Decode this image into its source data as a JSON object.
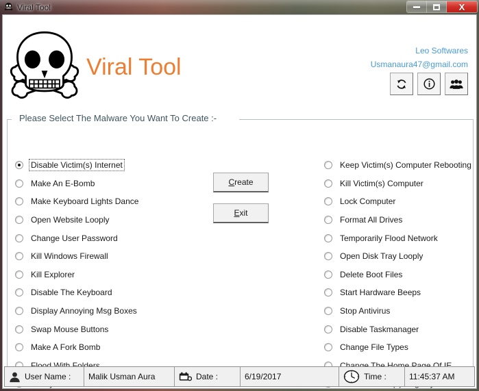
{
  "window": {
    "title": "Viral Tool",
    "icon": "skull-icon",
    "controls": {
      "minimize": "minimize-button",
      "maximize": "maximize-button",
      "close": "X"
    }
  },
  "header": {
    "logo_icon": "skull-and-crossbones-icon",
    "app_title": "Viral Tool",
    "app_title_color": "#ED7D31",
    "company": "Leo Softwares",
    "email": "Usmanaura47@gmail.com",
    "link_color": "#4a9ad6",
    "buttons": [
      {
        "name": "refresh-button",
        "icon": "refresh-icon"
      },
      {
        "name": "info-button",
        "icon": "info-icon"
      },
      {
        "name": "about-team-button",
        "icon": "people-icon"
      }
    ]
  },
  "groupbox": {
    "title": "Please Select The Malware You Want To Create :-",
    "title_color": "#3f5560"
  },
  "options": {
    "left": [
      {
        "label": "Disable Victim(s) Internet",
        "checked": true
      },
      {
        "label": "Make An E-Bomb",
        "checked": false
      },
      {
        "label": "Make Keyboard Lights Dance",
        "checked": false
      },
      {
        "label": "Open Website Looply",
        "checked": false
      },
      {
        "label": "Change User Password",
        "checked": false
      },
      {
        "label": "Kill Windows Firewall",
        "checked": false
      },
      {
        "label": "Kill Explorer",
        "checked": false
      },
      {
        "label": "Disable The Keyboard",
        "checked": false
      },
      {
        "label": "Display Annoying Msg Boxes",
        "checked": false
      },
      {
        "label": "Swap Mouse Buttons",
        "checked": false
      },
      {
        "label": "Make A Fork Bomb",
        "checked": false
      },
      {
        "label": "Flood With Folders",
        "checked": false
      },
      {
        "label": "Kill System Resources",
        "checked": false
      }
    ],
    "right": [
      {
        "label": "Keep Victim(s) Computer Rebooting",
        "checked": false
      },
      {
        "label": "Kill Victim(s) Computer",
        "checked": false
      },
      {
        "label": "Lock Computer",
        "checked": false
      },
      {
        "label": "Format All Drives",
        "checked": false
      },
      {
        "label": "Temporarily Flood Network",
        "checked": false
      },
      {
        "label": "Open Disk Tray Looply",
        "checked": false
      },
      {
        "label": "Delete Boot Files",
        "checked": false
      },
      {
        "label": "Start Hardware Beeps",
        "checked": false
      },
      {
        "label": "Stop Antivirus",
        "checked": false
      },
      {
        "label": "Disable Taskmanager",
        "checked": false
      },
      {
        "label": "Change File Types",
        "checked": false
      },
      {
        "label": "Change The Home Page Of IE",
        "checked": false
      },
      {
        "label": "Delete Victims(s) Registry",
        "checked": false
      }
    ]
  },
  "actions": {
    "create": {
      "accel": "C",
      "rest": "reate"
    },
    "exit": {
      "accel": "E",
      "rest": "xit"
    }
  },
  "statusbar": {
    "user_icon": "user-icon",
    "user_label": "User Name :",
    "user_value": "Malik Usman Aura",
    "date_icon": "calendar-icon",
    "date_label": "Date :",
    "date_value": "6/19/2017",
    "time_icon": "clock-icon",
    "time_label": "Time :",
    "time_value": "11:45:37 AM"
  }
}
